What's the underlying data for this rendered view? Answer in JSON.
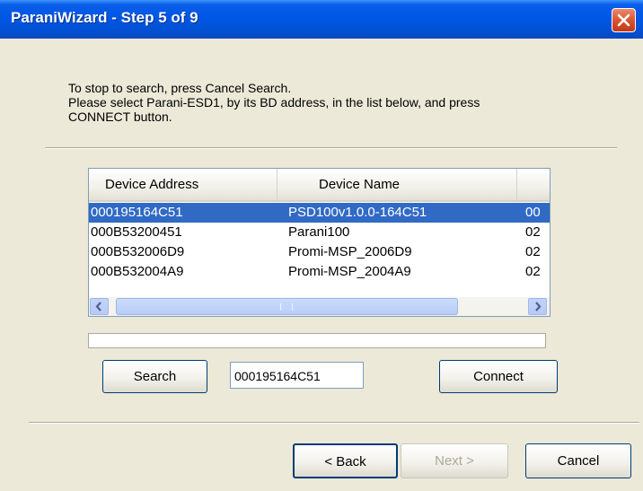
{
  "window": {
    "title": "ParaniWizard - Step 5 of 9"
  },
  "instructions": {
    "line1": "To stop to search, press Cancel Search.",
    "line2": "Please select Parani-ESD1, by its BD address, in the list below, and press",
    "line3": "CONNECT button."
  },
  "device_list": {
    "columns": [
      "Device Address",
      "Device Name",
      ""
    ],
    "rows": [
      {
        "address": "000195164C51",
        "name": "PSD100v1.0.0-164C51",
        "extra": "00",
        "selected": true
      },
      {
        "address": "000B53200451",
        "name": "Parani100",
        "extra": "02",
        "selected": false
      },
      {
        "address": "000B532006D9",
        "name": "Promi-MSP_2006D9",
        "extra": "02",
        "selected": false
      },
      {
        "address": "000B532004A9",
        "name": "Promi-MSP_2004A9",
        "extra": "02",
        "selected": false
      }
    ]
  },
  "search": {
    "button_label": "Search",
    "address_value": "000195164C51",
    "connect_label": "Connect",
    "progress_percent": 0
  },
  "nav": {
    "back_label": "< Back",
    "next_label": "Next >",
    "cancel_label": "Cancel"
  },
  "icons": {
    "close": "close-icon",
    "scroll_left": "arrow-left-icon",
    "scroll_right": "arrow-right-icon"
  },
  "colors": {
    "titlebar": "#0058e6",
    "selection": "#316ac5",
    "close_button": "#d8512d",
    "dialog_background": "#ece9d8"
  }
}
